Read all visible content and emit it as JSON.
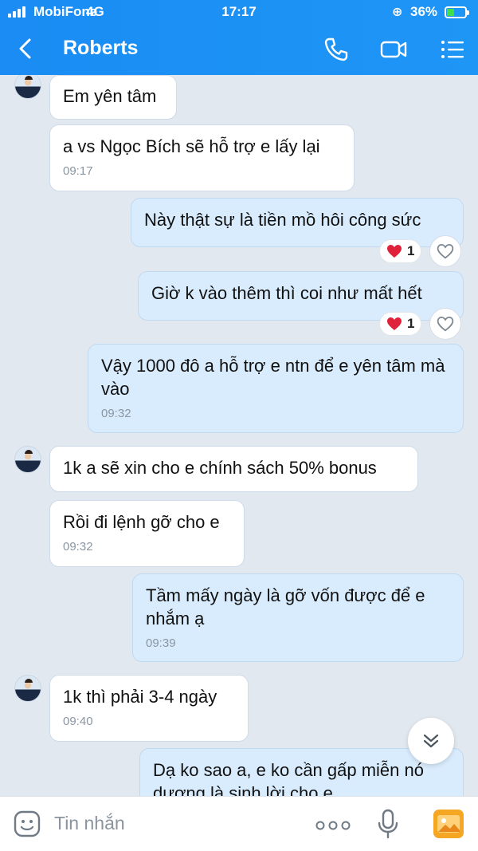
{
  "status": {
    "carrier": "MobiFone",
    "network": "4G",
    "time": "17:17",
    "battery": "36%",
    "battery_level": 0.36
  },
  "header": {
    "title": "Roberts",
    "accent": "#1a8cf3"
  },
  "messages": [
    {
      "text": "Em yên tâm",
      "time": ""
    },
    {
      "text": "a vs Ngọc Bích sẽ hỗ trợ e lấy lại",
      "time": "09:17"
    },
    {
      "text": "Này thật sự là tiền mồ hôi công sức",
      "time": "",
      "reaction_count": "1"
    },
    {
      "text": "Giờ k vào thêm thì coi như mất hết",
      "time": "",
      "reaction_count": "1"
    },
    {
      "text": "Vậy 1000 đô a hỗ trợ e ntn để e yên tâm mà vào",
      "time": "09:32"
    },
    {
      "text": "1k a sẽ xin cho e chính sách 50% bonus",
      "time": ""
    },
    {
      "text": "Rồi đi lệnh gỡ cho e",
      "time": "09:32"
    },
    {
      "text": "Tầm mấy ngày là gỡ vốn được để e nhắm ạ",
      "time": "09:39"
    },
    {
      "text": "1k thì phải 3-4 ngày",
      "time": "09:40"
    },
    {
      "text": "Dạ ko sao a, e ko cần gấp miễn nó dương là sinh lời cho e",
      "time": ""
    }
  ],
  "input": {
    "placeholder": "Tin nhắn"
  }
}
